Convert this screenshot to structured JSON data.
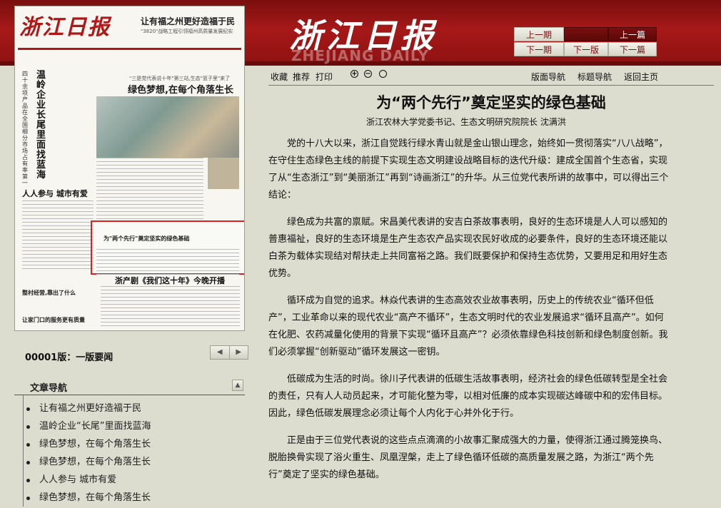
{
  "header": {
    "logo": "浙江日报",
    "logo_en": "ZHEJIANG DAILY",
    "nav": {
      "prev_issue": "上一期",
      "next_issue": "下一期",
      "prev_page": "上一版",
      "next_page": "下一版",
      "prev_article": "上一篇",
      "next_article": "下一篇"
    }
  },
  "paper": {
    "masthead": "浙江日报",
    "top_headline": "让有福之州更好造福于民",
    "top_sub": "\"3820\"战略工程引领福州高质量发展纪实",
    "vertical_headline": "温岭企业长尾里面找蓝海",
    "vertical_sub": "四十余项产品在全国细分市场占有率第一",
    "green_kicker": "\"三是党代表说十年\"第三站,生态\"篮子里\"来了",
    "green_headline": "绿色梦想,在每个角落生长",
    "renren": "人人参与 城市有爱",
    "boxed_title": "为\"两个先行\"奠定坚实的绿色基础",
    "drama": "浙产剧《我们这十年》今晚开播",
    "small1": "整村经营,靠出了什么",
    "small2": "让家门口的服务更有质量"
  },
  "page_label": "00001版：一版要闻",
  "nav_panel": {
    "title": "文章导航",
    "items": [
      "让有福之州更好造福于民",
      "温岭企业“长尾”里面找蓝海",
      "绿色梦想，在每个角落生长",
      "绿色梦想，在每个角落生长",
      "人人参与 城市有爱",
      "绿色梦想，在每个角落生长"
    ]
  },
  "toolbar": {
    "collect": "收藏",
    "recommend": "推荐",
    "print": "打印",
    "page_nav": "版面导航",
    "title_nav": "标题导航",
    "home": "返回主页"
  },
  "article": {
    "title": "为“两个先行”奠定坚实的绿色基础",
    "byline": "浙江农林大学党委书记、生态文明研究院院长 沈满洪",
    "paragraphs": [
      "党的十八大以来，浙江自觉践行绿水青山就是金山银山理念，始终如一贯彻落实“八八战略”，在守住生态绿色主线的前提下实现生态文明建设战略目标的迭代升级：建成全国首个生态省，实现了从“生态浙江”到“美丽浙江”再到“诗画浙江”的升华。从三位党代表所讲的故事中，可以得出三个结论：",
      "绿色成为共富的禀赋。宋昌美代表讲的安吉白茶故事表明，良好的生态环境是人人可以感知的普惠福祉，良好的生态环境是生产生态农产品实现农民好收成的必要条件，良好的生态环境还能以白茶为载体实现结对帮扶走上共同富裕之路。我们既要保护和保持生态优势，又要用足和用好生态优势。",
      "循环成为自觉的追求。林焱代表讲的生态高效农业故事表明，历史上的传统农业“循环但低产”，工业革命以来的现代农业“高产不循环”，生态文明时代的农业发展追求“循环且高产”。如何在化肥、农药减量化使用的背景下实现“循环且高产”？必须依靠绿色科技创新和绿色制度创新。我们必须掌握“创新驱动”循环发展这一密钥。",
      "低碳成为生活的时尚。徐川子代表讲的低碳生活故事表明，经济社会的绿色低碳转型是全社会的责任，只有人人动员起来，才可能化整为零，以相对低廉的成本实现碳达峰碳中和的宏伟目标。因此，绿色低碳发展理念必须让每个人内化于心并外化于行。",
      "正是由于三位党代表说的这些点点滴滴的小故事汇聚成强大的力量，使得浙江通过腾笼换鸟、脱胎换骨实现了浴火重生、凤凰涅槃，走上了绿色循环低碳的高质量发展之路，为浙江“两个先行”奠定了坚实的绿色基础。"
    ]
  }
}
